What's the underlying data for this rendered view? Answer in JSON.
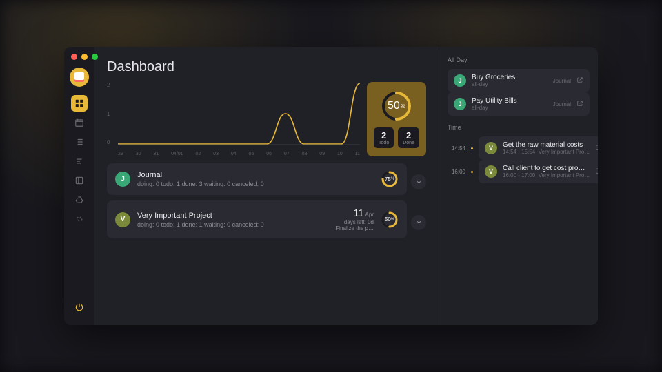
{
  "colors": {
    "accent": "#e8b838",
    "bg": "#1a1a20",
    "panel": "#202027",
    "card": "#2a2a32"
  },
  "title": "Dashboard",
  "chart_data": {
    "type": "line",
    "x": [
      "29",
      "30",
      "31",
      "04/01",
      "02",
      "03",
      "04",
      "05",
      "06",
      "07",
      "08",
      "09",
      "10",
      "11"
    ],
    "y": [
      0,
      0,
      0,
      0,
      0,
      0,
      0,
      0,
      0,
      1,
      0,
      0,
      0,
      2
    ],
    "yticks": [
      0,
      1,
      2
    ],
    "ylim": [
      0,
      2
    ]
  },
  "overall": {
    "percent": 50,
    "counts": [
      {
        "n": 2,
        "label": "Todo"
      },
      {
        "n": 2,
        "label": "Done"
      }
    ]
  },
  "projects": [
    {
      "badge": "J",
      "badgeClass": "badge-j",
      "name": "Journal",
      "stats": "doing: 0 todo: 1 done: 3 waiting: 0 canceled: 0",
      "percent": 75
    },
    {
      "badge": "V",
      "badgeClass": "badge-v",
      "name": "Very Important Project",
      "stats": "doing: 0 todo: 1 done: 1 waiting: 0 canceled: 0",
      "percent": 50,
      "day": 11,
      "month": "Apr",
      "daysLeft": "days left: 0d",
      "next": "Finalize the p…"
    }
  ],
  "sections": {
    "allday": "All Day",
    "time": "Time"
  },
  "allday": [
    {
      "badge": "J",
      "badgeClass": "badge-j",
      "title": "Buy Groceries",
      "sub": "all-day",
      "project": "Journal"
    },
    {
      "badge": "J",
      "badgeClass": "badge-j",
      "title": "Pay Utility Bills",
      "sub": "all-day",
      "project": "Journal"
    }
  ],
  "timed": [
    {
      "time": "14:54",
      "badge": "V",
      "badgeClass": "badge-v",
      "title": "Get the raw material costs",
      "sub": "14:54 - 15:54",
      "project": "Very Important Pro…"
    },
    {
      "time": "16:00",
      "badge": "V",
      "badgeClass": "badge-v",
      "title": "Call client to get cost pro…",
      "sub": "16:00 - 17:00",
      "project": "Very Important Pro…"
    }
  ]
}
